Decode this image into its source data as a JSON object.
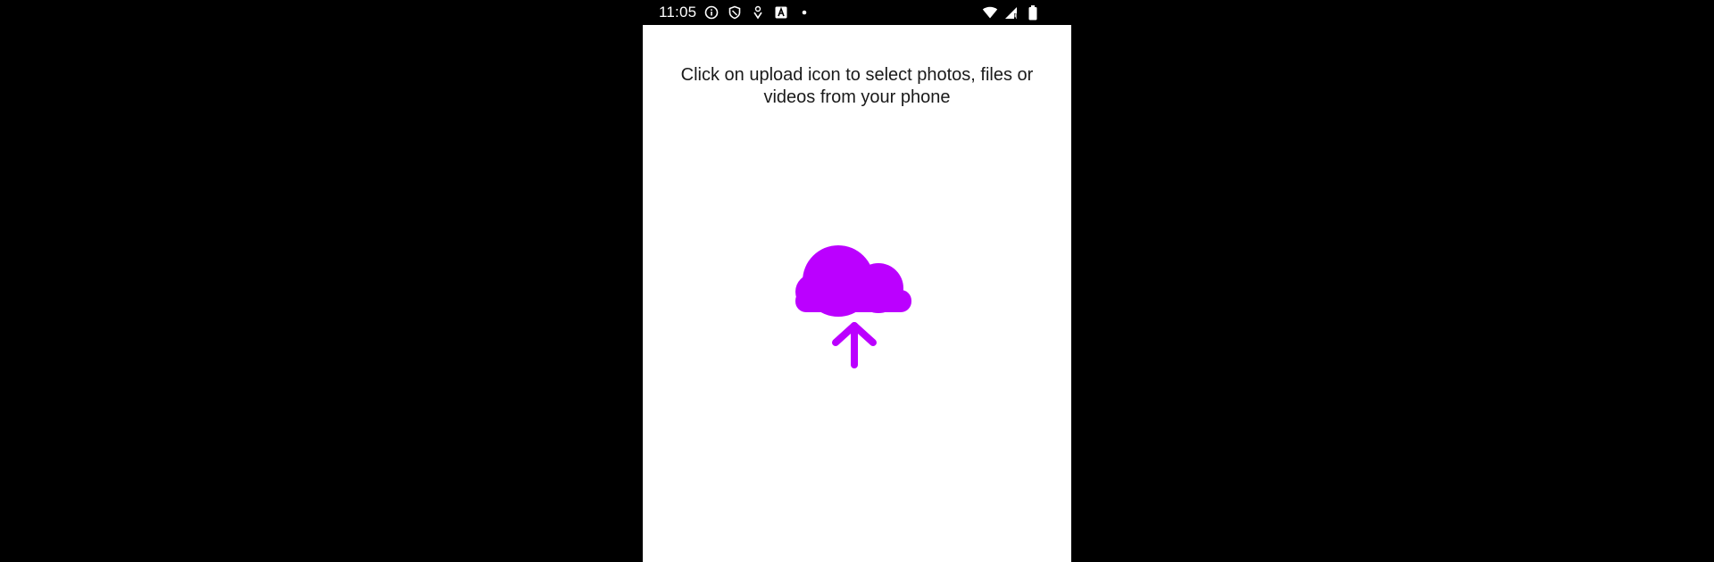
{
  "status_bar": {
    "time": "11:05",
    "icons": [
      "info-icon",
      "shield-icon",
      "location-pin-icon",
      "font-a-icon",
      "dot-icon"
    ],
    "right_icons": [
      "wifi-icon",
      "signal-icon",
      "battery-icon"
    ]
  },
  "main": {
    "instruction": "Click on upload icon to select photos, files or videos from your phone",
    "upload_icon": "cloud-upload-icon"
  },
  "colors": {
    "accent": "#BB00FF",
    "status_bar_bg": "#000000",
    "content_bg": "#FFFFFF",
    "text": "#1A1A1A"
  }
}
